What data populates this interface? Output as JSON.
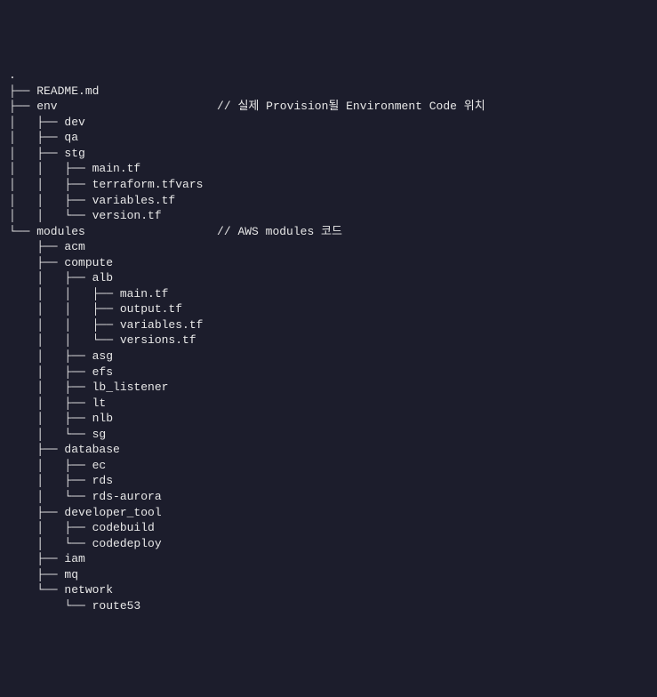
{
  "lines": [
    ".",
    "├── README.md",
    "├── env                       // 실제 Provision될 Environment Code 위치",
    "│   ├── dev",
    "│   ├── qa",
    "│   ├── stg",
    "│   │   ├── main.tf",
    "│   │   ├── terraform.tfvars",
    "│   │   ├── variables.tf",
    "│   │   └── version.tf",
    "└── modules                   // AWS modules 코드",
    "    ├── acm",
    "    ├── compute",
    "    │   ├── alb",
    "    │   │   ├── main.tf",
    "    │   │   ├── output.tf",
    "    │   │   ├── variables.tf",
    "    │   │   └── versions.tf",
    "    │   ├── asg",
    "    │   ├── efs",
    "    │   ├── lb_listener",
    "    │   ├── lt",
    "    │   ├── nlb",
    "    │   └── sg",
    "    ├── database",
    "    │   ├── ec",
    "    │   ├── rds",
    "    │   └── rds-aurora",
    "    ├── developer_tool",
    "    │   ├── codebuild",
    "    │   └── codedeploy",
    "    ├── iam",
    "    ├── mq",
    "    └── network",
    "        └── route53"
  ]
}
